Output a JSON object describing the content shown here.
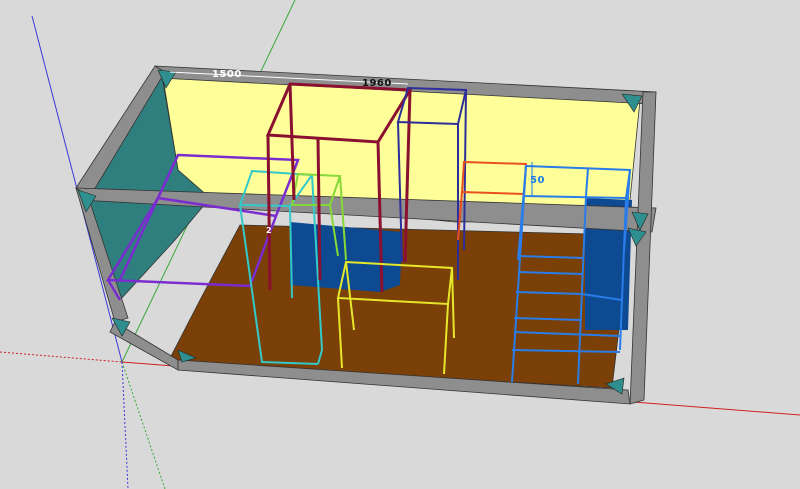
{
  "viewport": {
    "background": "#d9d9d9",
    "axes": {
      "x_color": "#d02020",
      "y_color": "#2a9a2a",
      "z_color": "#2a2ad0"
    }
  },
  "model": {
    "container_frame_color": "#8e8e8e",
    "wall_color": "#ffff99",
    "side_wall_color": "#2f7f7f",
    "floor_color": "#7a4008",
    "corner_fitting_color": "#2f8f8f",
    "block_color": "#0d4a92",
    "frames": [
      {
        "name": "red-rack",
        "color": "#8a1030"
      },
      {
        "name": "navy-rack",
        "color": "#2e2e9a"
      },
      {
        "name": "purple-bench",
        "color": "#7a2cd0"
      },
      {
        "name": "cyan-frame",
        "color": "#33c9c9"
      },
      {
        "name": "green-frame",
        "color": "#86d838"
      },
      {
        "name": "yellow-table",
        "color": "#e6e62a"
      },
      {
        "name": "orange-shelf",
        "color": "#e85020"
      },
      {
        "name": "blue-stairs",
        "color": "#2a7ce8"
      }
    ]
  },
  "dimensions": {
    "width_a": "1500",
    "width_b": "1960",
    "height_c": "50",
    "small_c": "2"
  }
}
